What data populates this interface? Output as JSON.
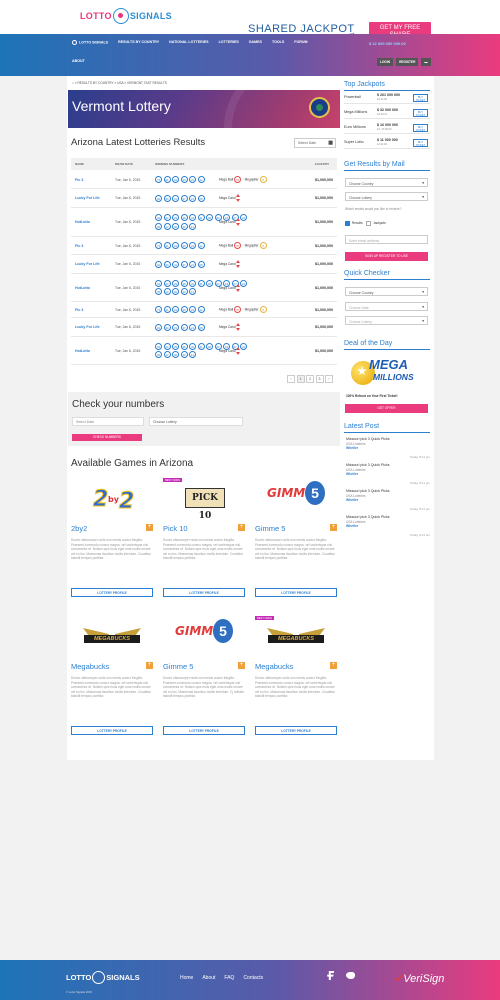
{
  "header": {
    "logo_left": "LOTTO",
    "logo_right": "SIGNALS",
    "jackpot_text": "SHARED JACKPOT",
    "cta_label": "GET MY FREE SHARE",
    "price": "$ 12 000 000 000.00",
    "nav": [
      "LOTTO SIGNALS",
      "RESULTS BY COUNTRY",
      "NATIONAL LOTTERIES",
      "LOTTERIES",
      "GAMES",
      "TOOLS",
      "FORUM"
    ],
    "nav_about": "ABOUT",
    "login": "LOGIN",
    "register": "REGISTER"
  },
  "breadcrumb": "» RESULTS BY COUNTRY » USA » VERMONT TAST RESULTS",
  "hero_title": "Vermont Lottery",
  "results": {
    "title": "Arizona Latest Lotteries Results",
    "select_date": "Select Date",
    "columns": [
      "NAME",
      "DRAW DATE",
      "WINNING NUMBERS",
      "JACKPOT"
    ],
    "rows": [
      {
        "name": "Pic 3",
        "date": "Tue, Jan 6, 2015",
        "balls": [
          "73",
          "41",
          "04",
          "20",
          "22",
          "12"
        ],
        "extra_label": "Mega Ball",
        "extra_ball": "37",
        "extra2_label": "Megaplier",
        "extra2_ball": "3",
        "jackpot": "$1,000,000"
      },
      {
        "name": "Lucky For Life",
        "date": "Tue, Jan 6, 2015",
        "balls": [
          "02",
          "30",
          "31",
          "37",
          "21",
          "08"
        ],
        "extra_label": "Mega Cand",
        "extra_arrows": true,
        "jackpot": "$1,000,000"
      },
      {
        "name": "HotLotto",
        "date": "Tue, Jan 6, 2015",
        "balls": [
          "03",
          "42",
          "29",
          "38",
          "32",
          "41",
          "06",
          "00",
          "18",
          "27",
          "22",
          "35",
          "12",
          "30",
          "40",
          "13"
        ],
        "extra_label": "Mega Cand",
        "extra_arrows": true,
        "jackpot": "$1,000,000"
      },
      {
        "name": "Pic 3",
        "date": "Tue, Jan 6, 2015",
        "balls": [
          "73",
          "41",
          "04",
          "20",
          "22",
          "12"
        ],
        "extra_label": "Mega Ball",
        "extra_ball": "37",
        "extra2_label": "Megaplier",
        "extra2_ball": "3",
        "jackpot": "$1,000,000"
      },
      {
        "name": "Lucky For Life",
        "date": "Tue, Jan 6, 2015",
        "balls": [
          "02",
          "30",
          "31",
          "37",
          "21",
          "08"
        ],
        "extra_label": "Mega Cand",
        "extra_arrows": true,
        "jackpot": "$1,000,000"
      },
      {
        "name": "HotLotto",
        "date": "Tue, Jan 6, 2015",
        "balls": [
          "03",
          "42",
          "29",
          "38",
          "32",
          "41",
          "06",
          "00",
          "18",
          "27",
          "22",
          "35",
          "12",
          "30",
          "40",
          "13"
        ],
        "extra_label": "Mega Cand",
        "extra_arrows": true,
        "jackpot": "$1,000,000"
      },
      {
        "name": "Pic 3",
        "date": "Tue, Jan 6, 2015",
        "balls": [
          "73",
          "41",
          "04",
          "20",
          "22",
          "12"
        ],
        "extra_label": "Mega Ball",
        "extra_ball": "37",
        "extra2_label": "Megaplier",
        "extra2_ball": "3",
        "jackpot": "$1,000,000"
      },
      {
        "name": "Lucky For Life",
        "date": "Tue, Jan 6, 2015",
        "balls": [
          "02",
          "30",
          "31",
          "37",
          "21",
          "08"
        ],
        "extra_label": "Mega Cand",
        "extra_arrows": true,
        "jackpot": "$1,000,000"
      },
      {
        "name": "HotLotto",
        "date": "Tue, Jan 6, 2015",
        "balls": [
          "03",
          "42",
          "29",
          "38",
          "32",
          "41",
          "06",
          "00",
          "18",
          "27",
          "22",
          "35",
          "12",
          "30",
          "40",
          "13"
        ],
        "extra_label": "Mega Cand",
        "extra_arrows": true,
        "jackpot": "$1,000,000"
      }
    ],
    "pager": [
      "‹",
      "1",
      "2",
      "3",
      "›"
    ]
  },
  "check": {
    "title": "Check your numbers",
    "select_date": "Select Date",
    "choose_lottery": "Choose Lottery",
    "button": "CHECK NUMBERS"
  },
  "games": {
    "title": "Available Games in Arizona",
    "items": [
      {
        "name": "2by2",
        "logo": "2by2",
        "badge": "",
        "desc": "Donec ullamcorper nulla non metus auctor fringilla. Praesent commodo cursus magna, vel scelerisque nisl consectetur et. Nullam quis risus eget urna mollis ornare vel eu leo. Maecenas faucibus mollis interdum. Curabitur blandit tempus porttitor.",
        "button": "LOTTERY PROFILE"
      },
      {
        "name": "Pick 10",
        "logo": "PICK 10",
        "badge": "BEST ODDS",
        "desc": "Donec ullamcorper nulla non metus auctor fringilla. Praesent commodo cursus magna, vel scelerisque nisl consectetur et. Nullam quis risus eget urna mollis ornare vel eu leo. Maecenas faucibus mollis interdum. Curabitur blandit tempus porttitor.",
        "button": "LOTTERY PROFILE"
      },
      {
        "name": "Gimme 5",
        "logo": "GIMME",
        "badge": "",
        "desc": "Donec ullamcorper nulla non metus auctor fringilla. Praesent commodo cursus magna, vel scelerisque nisl consectetur et. Nullam quis risus eget urna mollis ornare vel eu leo. Maecenas faucibus mollis interdum. Curabitur blandit tempus porttitor.",
        "button": "LOTTERY PROFILE"
      },
      {
        "name": "Megabucks",
        "logo": "MEGABUCKS",
        "badge": "",
        "desc": "Donec ullamcorper nulla non metus auctor fringilla. Praesent commodo cursus magna, vel scelerisque nisl consectetur et. Nullam quis risus eget urna mollis ornare vel eu leo. Maecenas faucibus mollis interdum. Curabitur blandit tempus porttitor.",
        "button": "LOTTERY PROFILE"
      },
      {
        "name": "Gimme 5",
        "logo": "GIMME",
        "badge": "",
        "desc": "Donec ullamcorper nulla non metus auctor fringilla. Praesent commodo cursus magna, vel scelerisque nisl consectetur et. Nullam quis risus eget urna mollis ornare vel eu leo. Maecenas faucibus mollis interdum. Cj ndibitur blandit tempus porttitor.",
        "button": "LOTTERY PROFILE"
      },
      {
        "name": "Megabucks",
        "logo": "MEGABUCKS",
        "badge": "BEST ODDS",
        "desc": "Donec ullamcorper nulla non metus auctor fringilla. Praesent commodo cursus magna, vel scelerisque nisl consectetur et. Nullam quis risus eget urna mollis ornare vel eu leo. Maecenas faucibus mollis interdum. Curabitur blandit tempus porttitor.",
        "button": "LOTTERY PROFILE"
      }
    ]
  },
  "sidebar": {
    "top_jackpots_title": "Top Jackpots",
    "jackpots": [
      {
        "name": "Powerball",
        "amount": "$ 261 000 000",
        "time": "1d:11:46",
        "button": "BUY TICKET"
      },
      {
        "name": "Mega Millions",
        "amount": "$ 32 000 000",
        "time": "1d:13:11",
        "button": "BUY TICKET"
      },
      {
        "name": "Euro Millions",
        "amount": "$ 16 000 000",
        "time": "1d, 47:00:00",
        "button": "BUY TICKET"
      },
      {
        "name": "Super Lotto",
        "amount": "$ 11 000 000",
        "time": "1d:11:46",
        "button": "BUY TICKET"
      }
    ],
    "mail_title": "Get Results by Mail",
    "choose_country": "Choose Country",
    "choose_lottery": "Choose Lottery",
    "receive_q": "Which emails would you like to receive?",
    "opt_results": "Results",
    "opt_jackpots": "Jackpots",
    "email_placeholder": "Enter email address",
    "signup": "SIGN UP REGISTER TO USE",
    "quick_title": "Quick Checker",
    "qc_country": "Choose Country",
    "qc_date": "Choose Date",
    "qc_lottery": "Choose Lottery",
    "deal_title": "Deal of the Day",
    "deal_logo_1": "MEGA",
    "deal_logo_2": "MILLIONS",
    "deal_text": "100% Refund on Your First Ticket!",
    "deal_button": "GET OFFER",
    "latest_title": "Latest Post",
    "posts": [
      {
        "title": "Missouri pick 3 Quick Picks",
        "cat": "USA Lotteries",
        "author": "Wheller",
        "date": "Today, 8:11 pm"
      },
      {
        "title": "Missouri pick 3 Quick Picks",
        "cat": "USA Lotteries",
        "author": "Wheller",
        "date": "Today, 8:11 pm"
      },
      {
        "title": "Missouri pick 3 Quick Picks",
        "cat": "USA Lotteries",
        "author": "Wheller",
        "date": "Today, 8:11 pm"
      },
      {
        "title": "Missouri pick 3 Quick Picks",
        "cat": "USA Lotteries",
        "author": "Wheller",
        "date": "Today, 8:11 pm"
      }
    ]
  },
  "footer": {
    "logo_left": "LOTTO",
    "logo_right": "SIGNALS",
    "copyright": "© Lotto Signals 2015",
    "links": [
      "Home",
      "About",
      "FAQ",
      "Contacts"
    ],
    "verisign": "VeriSign"
  },
  "colors": {
    "accent_pink": "#ea3b7e",
    "accent_blue": "#2b7fd0"
  }
}
